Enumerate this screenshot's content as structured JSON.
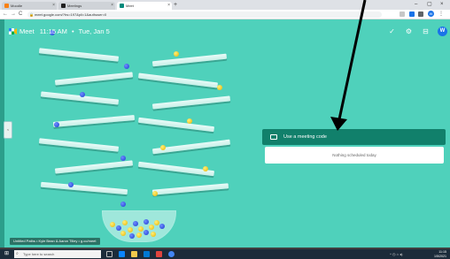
{
  "browser": {
    "tabs": [
      {
        "title": "Moodle",
        "color": "#f98012"
      },
      {
        "title": "Meetings",
        "color": "#1f1f1f"
      },
      {
        "title": "Meet",
        "color": "#00897b"
      }
    ],
    "new_tab": "+",
    "tab_close": "×",
    "window_controls": [
      "–",
      "▢",
      "×"
    ],
    "url": "meet.google.com/?hs=197&pli=1&authuser=0",
    "nav": [
      "←",
      "→",
      "C"
    ],
    "profile_letter": "W"
  },
  "meet": {
    "brand": "Meet",
    "time": "11:15 AM",
    "separator": "•",
    "date": "Tue, Jan 5",
    "use_code_label": "Use a meeting code",
    "nothing_scheduled": "Nothing scheduled today",
    "avatar_letter": "W",
    "side_tab": "<",
    "colors": {
      "background": "#4fd1bb",
      "panel_header": "#11806b",
      "avatar": "#1a73e8"
    }
  },
  "artwork": {
    "credit": "Untitled Paths • Kyle Bean & Aaron Tilley • g.co/meet"
  },
  "taskbar": {
    "search_placeholder": "Type here to search",
    "time": "11:15",
    "date": "1/5/2021"
  }
}
